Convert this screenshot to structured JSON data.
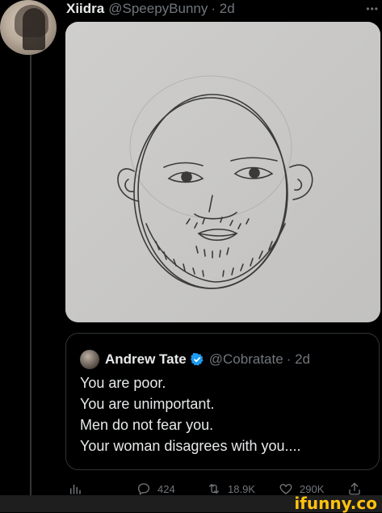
{
  "tweet": {
    "author_name": "Xiidra",
    "author_handle": "@SpeepyBunny",
    "timestamp": "· 2d",
    "more_icon": "ellipsis-icon"
  },
  "quote": {
    "author_name": "Andrew Tate",
    "author_handle": "@Cobratate",
    "timestamp": "· 2d",
    "verified_color": "#1d9bf0",
    "lines": [
      "You are poor.",
      "You are unimportant.",
      "Men do not fear you.",
      "Your woman disagrees with you...."
    ]
  },
  "actions": {
    "replies": "424",
    "retweets": "18.9K",
    "likes": "290K"
  },
  "watermark": "ifunny.co",
  "colors": {
    "background": "#000000",
    "text": "#e7e9ea",
    "secondary": "#71767b",
    "border": "#2f3336",
    "watermark": "#ffc20e"
  }
}
